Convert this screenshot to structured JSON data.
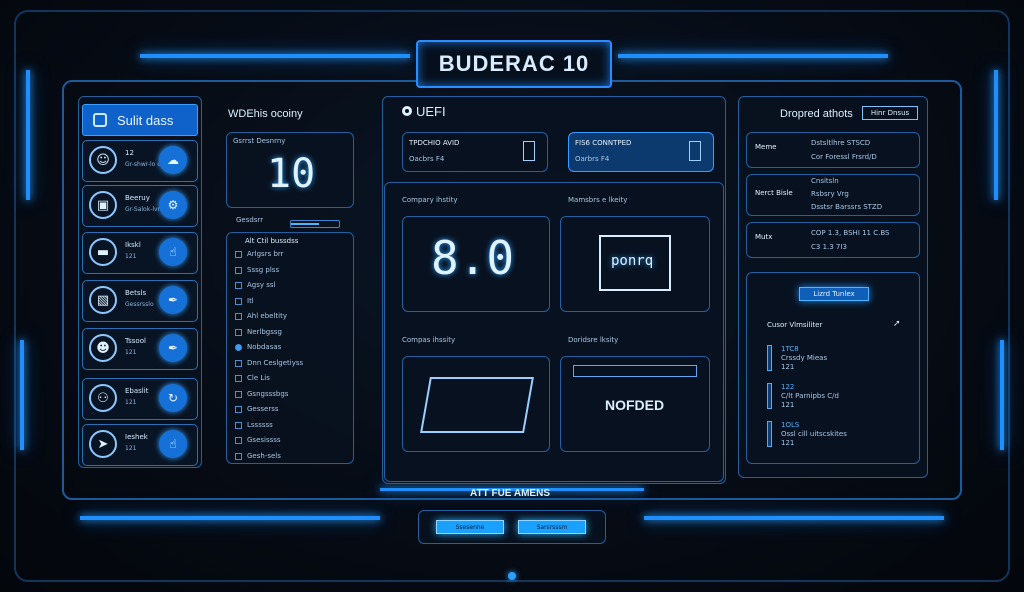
{
  "header": {
    "title": "BUDERAC 10"
  },
  "sidebar": {
    "title": "Sulit dass",
    "items": [
      {
        "label": "12",
        "sub": "Gr-shwr-lo ok"
      },
      {
        "label": "Beeruy",
        "sub": "Gr-Salok-lvre"
      },
      {
        "label": "Ikskl",
        "sub": "121"
      },
      {
        "label": "Betsls",
        "sub": "Gessrsslo"
      },
      {
        "label": "Tssool",
        "sub": "121"
      },
      {
        "label": "Ebaslit",
        "sub": "121"
      },
      {
        "label": "Ieshek",
        "sub": "121"
      }
    ]
  },
  "col2": {
    "title": "WDEhis ocoiny",
    "box_label": "Gsrrst Desnrny",
    "big_value": "10",
    "section_label": "Gesdsrr",
    "list_title": "Alt Ctil bussdss",
    "list": [
      {
        "text": "Arlgsrs brr",
        "on": false
      },
      {
        "text": "Sssg plss",
        "on": false
      },
      {
        "text": "Agsy ssl",
        "on": false
      },
      {
        "text": "Itl",
        "on": false
      },
      {
        "text": "Ahl ebeltity",
        "on": false
      },
      {
        "text": "Nerlbgssg",
        "on": false
      },
      {
        "text": "Nobdasas",
        "on": true
      },
      {
        "text": "Dnn Ceslgetiyss",
        "on": false
      },
      {
        "text": "Cle Lis",
        "on": false
      },
      {
        "text": "Gsngsssbgs",
        "on": false
      },
      {
        "text": "Gesserss",
        "on": false
      },
      {
        "text": "Lssssss",
        "on": false
      },
      {
        "text": "Gsesissss",
        "on": false
      },
      {
        "text": "Gesh-sels",
        "on": false
      }
    ]
  },
  "main": {
    "title": "UEFI",
    "card1": {
      "title": "TPDCHIO AVID",
      "sub": "Oacbrs F4"
    },
    "card2": {
      "title": "FIS6 CONNTPED",
      "sub": "Oarbrs F4"
    },
    "tiles": [
      {
        "label": "Compary ihstity",
        "value": "8.0"
      },
      {
        "label": "Mamsbrs e lkeity",
        "value": "ponrq"
      },
      {
        "label": "Compas ihssity",
        "value": ""
      },
      {
        "label": "Doridsre lksity",
        "value": "NOFDED"
      }
    ]
  },
  "right": {
    "title": "Dropred athots",
    "button": "Hinr Dnsus",
    "groups": [
      {
        "key": "Meme",
        "lines": [
          "Dstsltlhre STSCD",
          "Cor Foressl Frsrd/D"
        ]
      },
      {
        "key": "Nerct Bisle",
        "lines": [
          "Cnsitsln",
          "Rsbsry Vrg",
          "Dsstsr Barssrs STZD"
        ]
      },
      {
        "key": "Mutx",
        "lines": [
          "COP 1.3, BSHI 11 C.BS",
          "C3 1.3 7I3"
        ]
      }
    ],
    "legend": {
      "badge": "Lizrd Tunlex",
      "header": "Cusor Vlmsiliter",
      "items": [
        {
          "a": "1TC8",
          "b": "Crssdy Mieas",
          "c": "121"
        },
        {
          "a": "122",
          "b": "C/lt Parnipbs C/d",
          "c": "121"
        },
        {
          "a": "1OLS",
          "b": "Ossl cill uitscskites",
          "c": "121"
        }
      ]
    }
  },
  "footer": {
    "title": "ATT FUE AMENS",
    "btn1": "Ssesenne",
    "btn2": "Sarsrsssm"
  }
}
